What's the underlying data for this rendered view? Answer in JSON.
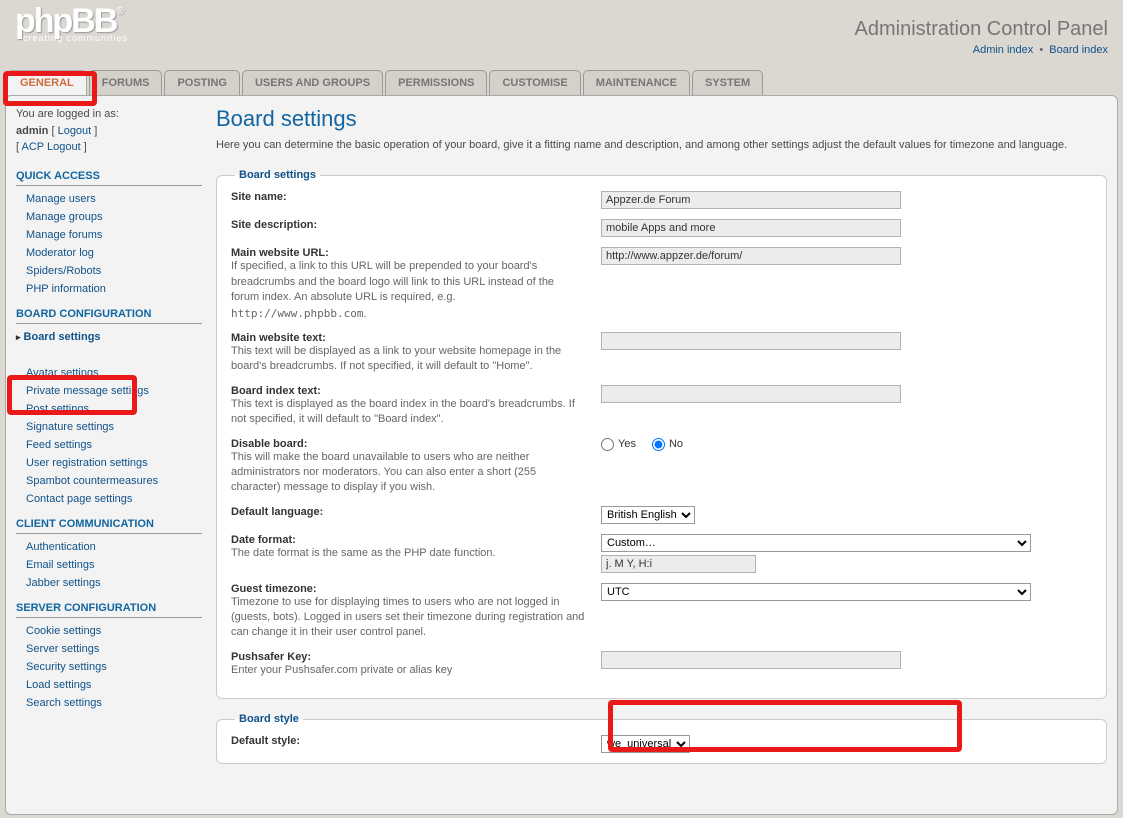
{
  "header": {
    "logo_text": "phpBB",
    "logo_sup": "®",
    "logo_sub": "creating communities",
    "title": "Administration Control Panel",
    "link_admin": "Admin index",
    "link_board": "Board index"
  },
  "tabs": [
    "GENERAL",
    "FORUMS",
    "POSTING",
    "USERS AND GROUPS",
    "PERMISSIONS",
    "CUSTOMISE",
    "MAINTENANCE",
    "SYSTEM"
  ],
  "login": {
    "text": "You are logged in as:",
    "user": "admin",
    "logout": "Logout",
    "acp_logout": "ACP Logout"
  },
  "sidebar": {
    "quick_access": {
      "title": "QUICK ACCESS",
      "items": [
        "Manage users",
        "Manage groups",
        "Manage forums",
        "Moderator log",
        "Spiders/Robots",
        "PHP information"
      ]
    },
    "board_config": {
      "title": "BOARD CONFIGURATION",
      "items": [
        "Board settings",
        "Avatar settings",
        "Private message settings",
        "Post settings",
        "Signature settings",
        "Feed settings",
        "User registration settings",
        "Spambot countermeasures",
        "Contact page settings"
      ]
    },
    "client_comm": {
      "title": "CLIENT COMMUNICATION",
      "items": [
        "Authentication",
        "Email settings",
        "Jabber settings"
      ]
    },
    "server_config": {
      "title": "SERVER CONFIGURATION",
      "items": [
        "Cookie settings",
        "Server settings",
        "Security settings",
        "Load settings",
        "Search settings"
      ]
    }
  },
  "page": {
    "title": "Board settings",
    "desc": "Here you can determine the basic operation of your board, give it a fitting name and description, and among other settings adjust the default values for timezone and language."
  },
  "fieldset1": {
    "legend": "Board settings",
    "site_name": {
      "label": "Site name:",
      "value": "Appzer.de Forum"
    },
    "site_desc": {
      "label": "Site description:",
      "value": "mobile Apps and more"
    },
    "main_url": {
      "label": "Main website URL:",
      "help": "If specified, a link to this URL will be prepended to your board's breadcrumbs and the board logo will link to this URL instead of the forum index. An absolute URL is required, e.g. ",
      "code": "http://www.phpbb.com",
      "value": "http://www.appzer.de/forum/"
    },
    "main_text": {
      "label": "Main website text:",
      "help": "This text will be displayed as a link to your website homepage in the board's breadcrumbs. If not specified, it will default to \"Home\".",
      "value": ""
    },
    "board_index": {
      "label": "Board index text:",
      "help": "This text is displayed as the board index in the board's breadcrumbs. If not specified, it will default to \"Board index\".",
      "value": ""
    },
    "disable": {
      "label": "Disable board:",
      "help": "This will make the board unavailable to users who are neither administrators nor moderators. You can also enter a short (255 character) message to display if you wish.",
      "yes": "Yes",
      "no": "No"
    },
    "lang": {
      "label": "Default language:",
      "value": "British English"
    },
    "date": {
      "label": "Date format:",
      "help": "The date format is the same as the PHP date function.",
      "select": "Custom…",
      "input": "j. M Y, H:i"
    },
    "tz": {
      "label": "Guest timezone:",
      "help": "Timezone to use for displaying times to users who are not logged in (guests, bots). Logged in users set their timezone during registration and can change it in their user control panel.",
      "value": "UTC"
    },
    "push": {
      "label": "Pushsafer Key:",
      "help": "Enter your Pushsafer.com private or alias key",
      "value": ""
    }
  },
  "fieldset2": {
    "legend": "Board style",
    "default_style": {
      "label": "Default style:",
      "value": "we_universal"
    }
  }
}
